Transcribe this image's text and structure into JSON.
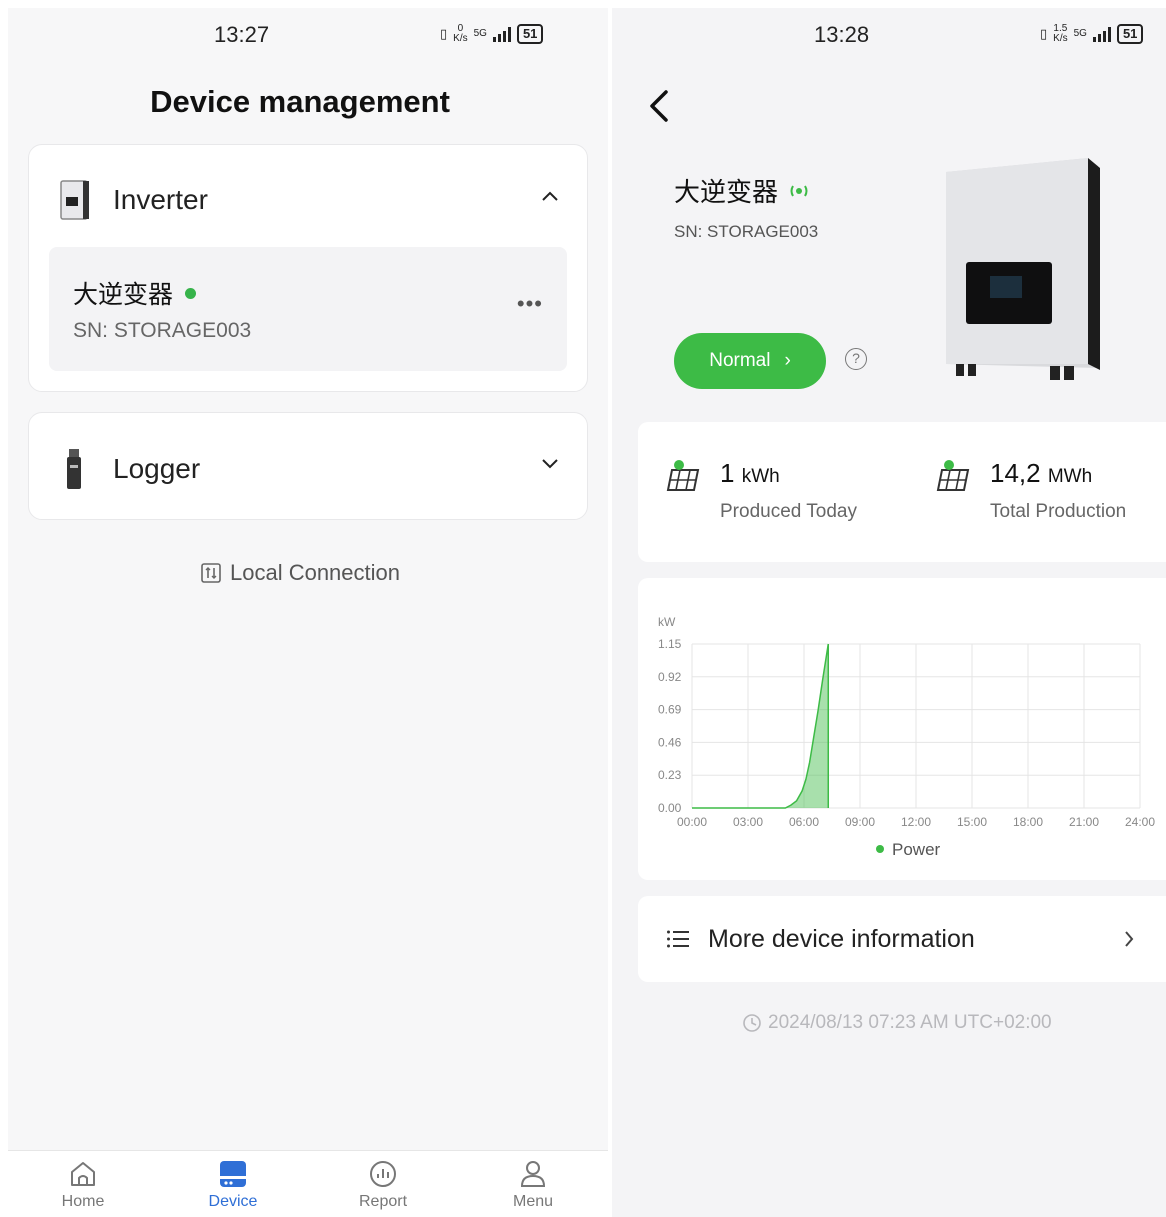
{
  "left_screen": {
    "status_bar": {
      "time": "13:27",
      "data_rate": "0",
      "data_unit": "K/s",
      "network": "5G",
      "battery": "51"
    },
    "title": "Device management",
    "inverter_section": {
      "label": "Inverter",
      "device": {
        "name": "大逆变器",
        "sn": "SN: STORAGE003",
        "more": "•••"
      }
    },
    "logger_section": {
      "label": "Logger"
    },
    "local_connection": "Local Connection",
    "tabs": [
      {
        "label": "Home",
        "icon": "home-icon"
      },
      {
        "label": "Device",
        "icon": "device-icon",
        "active": true
      },
      {
        "label": "Report",
        "icon": "report-icon"
      },
      {
        "label": "Menu",
        "icon": "user-icon"
      }
    ]
  },
  "right_screen": {
    "status_bar": {
      "time": "13:28",
      "data_rate": "1.5",
      "data_unit": "K/s",
      "network": "5G",
      "battery": "51"
    },
    "device": {
      "name": "大逆变器",
      "sn": "SN: STORAGE003",
      "status": "Normal"
    },
    "production": {
      "today": {
        "value": "1",
        "unit": "kWh",
        "label": "Produced Today"
      },
      "total": {
        "value": "14,2",
        "unit": "MWh",
        "label": "Total Production"
      }
    },
    "more_info": "More device information",
    "timestamp": "2024/08/13 07:23 AM UTC+02:00"
  },
  "chart_data": {
    "type": "area",
    "ylabel": "kW",
    "x_ticks": [
      "00:00",
      "03:00",
      "06:00",
      "09:00",
      "12:00",
      "15:00",
      "18:00",
      "21:00",
      "24:00"
    ],
    "y_ticks": [
      "0.00",
      "0.23",
      "0.46",
      "0.69",
      "0.92",
      "1.15"
    ],
    "ylim": [
      0,
      1.15
    ],
    "xlim_hours": [
      0,
      24
    ],
    "series": [
      {
        "name": "Power",
        "color": "#3dbb46",
        "x_hours": [
          0,
          5.0,
          5.3,
          5.6,
          5.9,
          6.1,
          6.3,
          6.5,
          6.75,
          7.0,
          7.3
        ],
        "y": [
          0,
          0,
          0.02,
          0.05,
          0.12,
          0.2,
          0.32,
          0.48,
          0.68,
          0.9,
          1.15
        ]
      }
    ],
    "legend_position": "bottom"
  },
  "colors": {
    "accent": "#3dbb46",
    "tab_active": "#2f6fd6"
  }
}
